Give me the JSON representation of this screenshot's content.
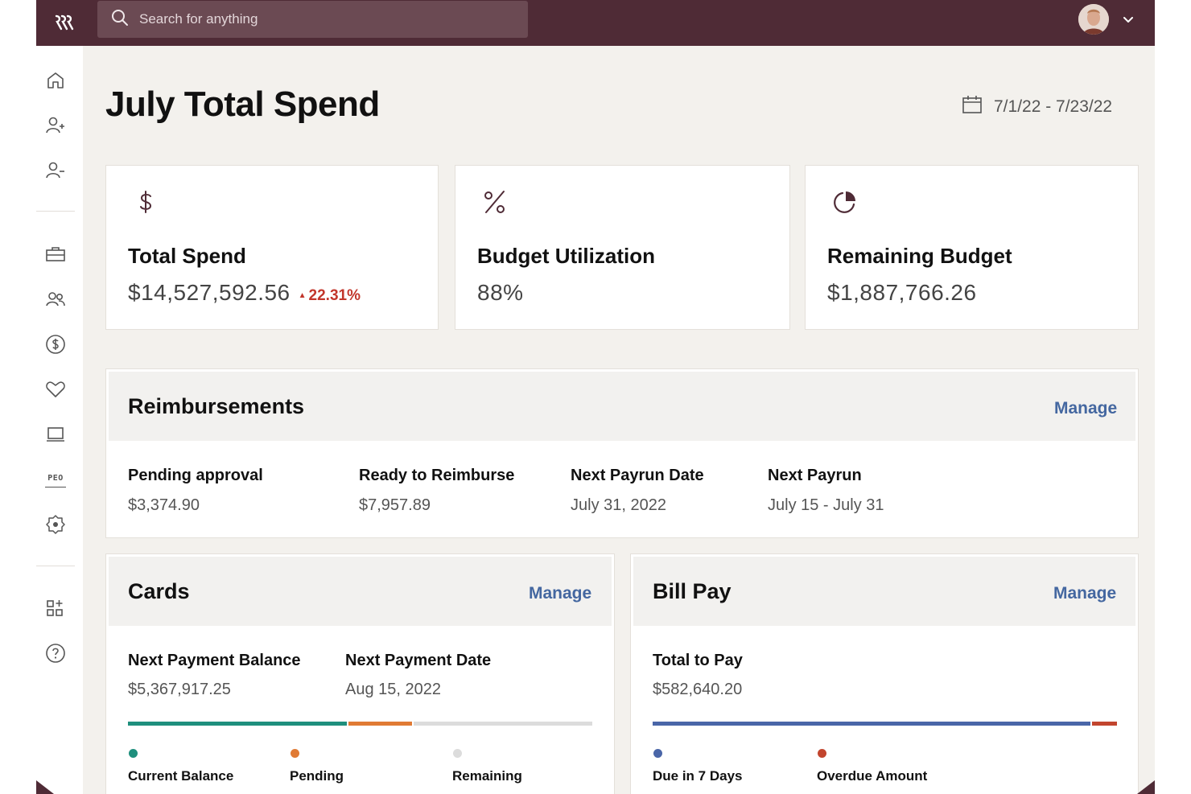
{
  "search": {
    "placeholder": "Search for anything"
  },
  "page": {
    "title": "July Total Spend",
    "date_range": "7/1/22 - 7/23/22"
  },
  "stats": [
    {
      "icon": "dollar-icon",
      "label": "Total Spend",
      "value": "$14,527,592.56",
      "change": "22.31%",
      "change_direction": "up",
      "change_color": "#c2362b"
    },
    {
      "icon": "percent-icon",
      "label": "Budget Utilization",
      "value": "88%"
    },
    {
      "icon": "pie-chart-icon",
      "label": "Remaining Budget",
      "value": "$1,887,766.26"
    }
  ],
  "reimbursements": {
    "title": "Reimbursements",
    "manage": "Manage",
    "fields": [
      {
        "label": "Pending approval",
        "value": "$3,374.90"
      },
      {
        "label": "Ready to Reimburse",
        "value": "$7,957.89"
      },
      {
        "label": "Next Payrun Date",
        "value": "July 31, 2022"
      },
      {
        "label": "Next Payrun",
        "value": "July 15 - July 31"
      }
    ]
  },
  "cards": {
    "title": "Cards",
    "manage": "Manage",
    "fields": [
      {
        "label": "Next Payment Balance",
        "value": "$5,367,917.25"
      },
      {
        "label": "Next Payment Date",
        "value": "Aug 15, 2022"
      }
    ],
    "bar": [
      {
        "name": "Current Balance",
        "fraction": 0.475,
        "color": "#1f8f7d"
      },
      {
        "name": "Pending",
        "fraction": 0.14,
        "color": "#e07a34"
      },
      {
        "name": "Remaining",
        "fraction": 0.385,
        "color": "#dcdcdc"
      }
    ],
    "legend": [
      {
        "label": "Current Balance",
        "color": "#1f8f7d"
      },
      {
        "label": "Pending",
        "color": "#e07a34"
      },
      {
        "label": "Remaining",
        "color": "#dcdcdc"
      }
    ]
  },
  "bill_pay": {
    "title": "Bill Pay",
    "manage": "Manage",
    "fields": [
      {
        "label": "Total to Pay",
        "value": "$582,640.20"
      }
    ],
    "bar": [
      {
        "name": "Due in 7 Days",
        "fraction": 0.947,
        "color": "#4a66a8"
      },
      {
        "name": "Overdue Amount",
        "fraction": 0.053,
        "color": "#c2452e"
      }
    ],
    "legend": [
      {
        "label": "Due in 7 Days",
        "color": "#4a66a8"
      },
      {
        "label": "Overdue Amount",
        "color": "#c2452e"
      }
    ]
  },
  "sidebar": {
    "items": [
      "home-icon",
      "add-user-icon",
      "remove-user-icon",
      "briefcase-icon",
      "people-icon",
      "dollar-circle-icon",
      "heart-icon",
      "laptop-icon",
      "peo-icon",
      "settings-icon",
      "apps-icon",
      "help-icon"
    ],
    "peo_label": "PEO"
  },
  "colors": {
    "topbar": "#4f2b36",
    "accent_link": "#4467a0",
    "background": "#f3f1ed"
  }
}
